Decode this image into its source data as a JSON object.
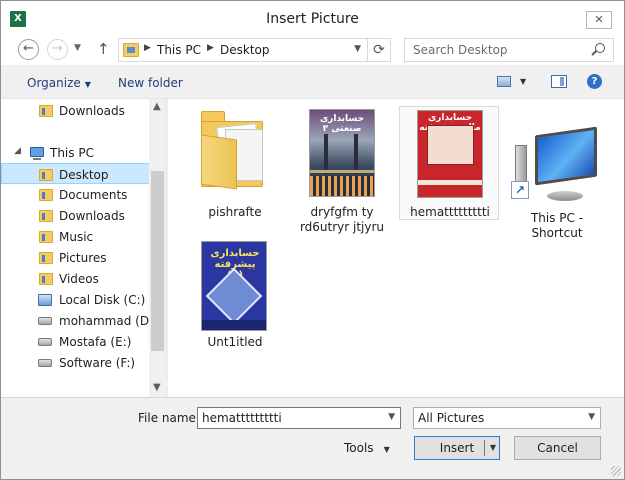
{
  "window": {
    "title": "Insert Picture",
    "app_icon": "excel-icon",
    "close_glyph": "✕"
  },
  "nav": {
    "back_glyph": "←",
    "forward_glyph": "→",
    "up_glyph": "↑",
    "breadcrumb": [
      "This PC",
      "Desktop"
    ],
    "refresh_glyph": "⟳"
  },
  "search": {
    "placeholder": "Search Desktop"
  },
  "toolbar": {
    "organize_label": "Organize",
    "new_folder_label": "New folder",
    "help_glyph": "?"
  },
  "sidebar": {
    "items": [
      {
        "label": "Downloads",
        "icon": "folder-icon"
      },
      {
        "label": "This PC",
        "icon": "computer-icon"
      },
      {
        "label": "Desktop",
        "icon": "folder-icon",
        "selected": true
      },
      {
        "label": "Documents",
        "icon": "folder-icon"
      },
      {
        "label": "Downloads",
        "icon": "folder-icon"
      },
      {
        "label": "Music",
        "icon": "folder-icon"
      },
      {
        "label": "Pictures",
        "icon": "folder-icon"
      },
      {
        "label": "Videos",
        "icon": "folder-icon"
      },
      {
        "label": "Local Disk (C:)",
        "icon": "drive-icon"
      },
      {
        "label": "mohammad (D:)",
        "icon": "drive-icon"
      },
      {
        "label": "Mostafa (E:)",
        "icon": "drive-icon"
      },
      {
        "label": "Software (F:)",
        "icon": "drive-icon"
      }
    ]
  },
  "files": [
    {
      "name": "pishrafte",
      "type": "folder"
    },
    {
      "name": "dryfgfm ty rd6utryr jtjyru",
      "type": "image"
    },
    {
      "name": "hemattttttttti",
      "type": "image",
      "selected": true
    },
    {
      "name": "This PC - Shortcut",
      "type": "shortcut"
    },
    {
      "name": "Unt1itled",
      "type": "image"
    }
  ],
  "book_titles": {
    "book1": "حسابداری صنعتی ۳",
    "book2": "حسابداری مالی پیشرفته",
    "book3": "حسابداری پیشرفته (1)"
  },
  "bottom": {
    "file_name_label": "File name:",
    "file_name_value": "hemattttttttti",
    "filter_value": "All Pictures",
    "tools_label": "Tools",
    "insert_label": "Insert",
    "cancel_label": "Cancel"
  }
}
